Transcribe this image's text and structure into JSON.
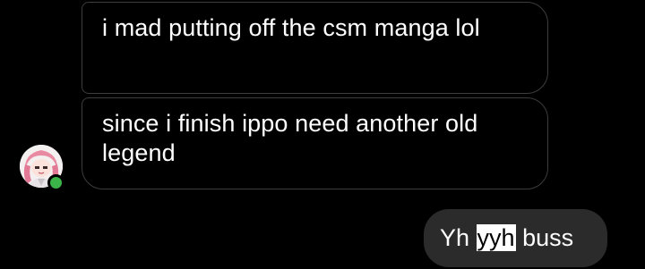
{
  "colors": {
    "background": "#000000",
    "incoming_bubble_border": "#3d3d3d",
    "outgoing_bubble": "#2b2b2b",
    "online_indicator": "#3bb54a",
    "text": "#ffffff"
  },
  "messages": [
    {
      "direction": "incoming",
      "text": "i mad putting off the csm manga lol"
    },
    {
      "direction": "incoming",
      "text": "since i finish ippo need another old legend"
    }
  ],
  "reply": {
    "direction": "outgoing",
    "text_before": "Yh ",
    "highlighted": "yyh",
    "text_after": " buss"
  },
  "sender": {
    "avatar": "pink-haired-anime-avatar",
    "status_icon": "online-status-icon"
  }
}
